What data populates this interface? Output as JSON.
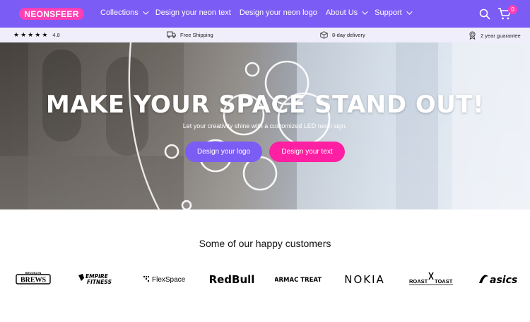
{
  "brand": {
    "logo_text": "NEONSFEER",
    "accent": "#7b5cf5",
    "pink": "#ff3fb4"
  },
  "nav": {
    "items": [
      {
        "label": "Collections",
        "dropdown": true
      },
      {
        "label": "Design your neon text",
        "dropdown": false
      },
      {
        "label": "Design your neon logo",
        "dropdown": false
      },
      {
        "label": "About Us",
        "dropdown": true
      },
      {
        "label": "Support",
        "dropdown": true
      }
    ],
    "cart_count": "0"
  },
  "trustbar": {
    "rating": "4.8",
    "stars": 5,
    "shipping": "Free Shipping",
    "delivery": "8-day delivery",
    "guarantee": "2 year guarantee"
  },
  "hero": {
    "title": "MAKE YOUR SPACE STAND OUT!",
    "subtitle": "Let your creativity shine with a customized LED neon sign.",
    "btn_logo": "Design your logo",
    "btn_text": "Design your text"
  },
  "customers": {
    "title": "Some of our happy customers",
    "logos": [
      "BREWS",
      "EMPIRE FITNESS",
      "FlexSpace",
      "RedBull",
      "TARMAC TREATS",
      "NOKIA",
      "ROAST TOAST",
      "asics"
    ],
    "logo_small_text": {
      "brews_top": "BROOKLYN",
      "empire_top": "EMPIRE",
      "empire_bottom": "FITNESS",
      "roast": "ROAST",
      "toast": "TOAST"
    }
  }
}
